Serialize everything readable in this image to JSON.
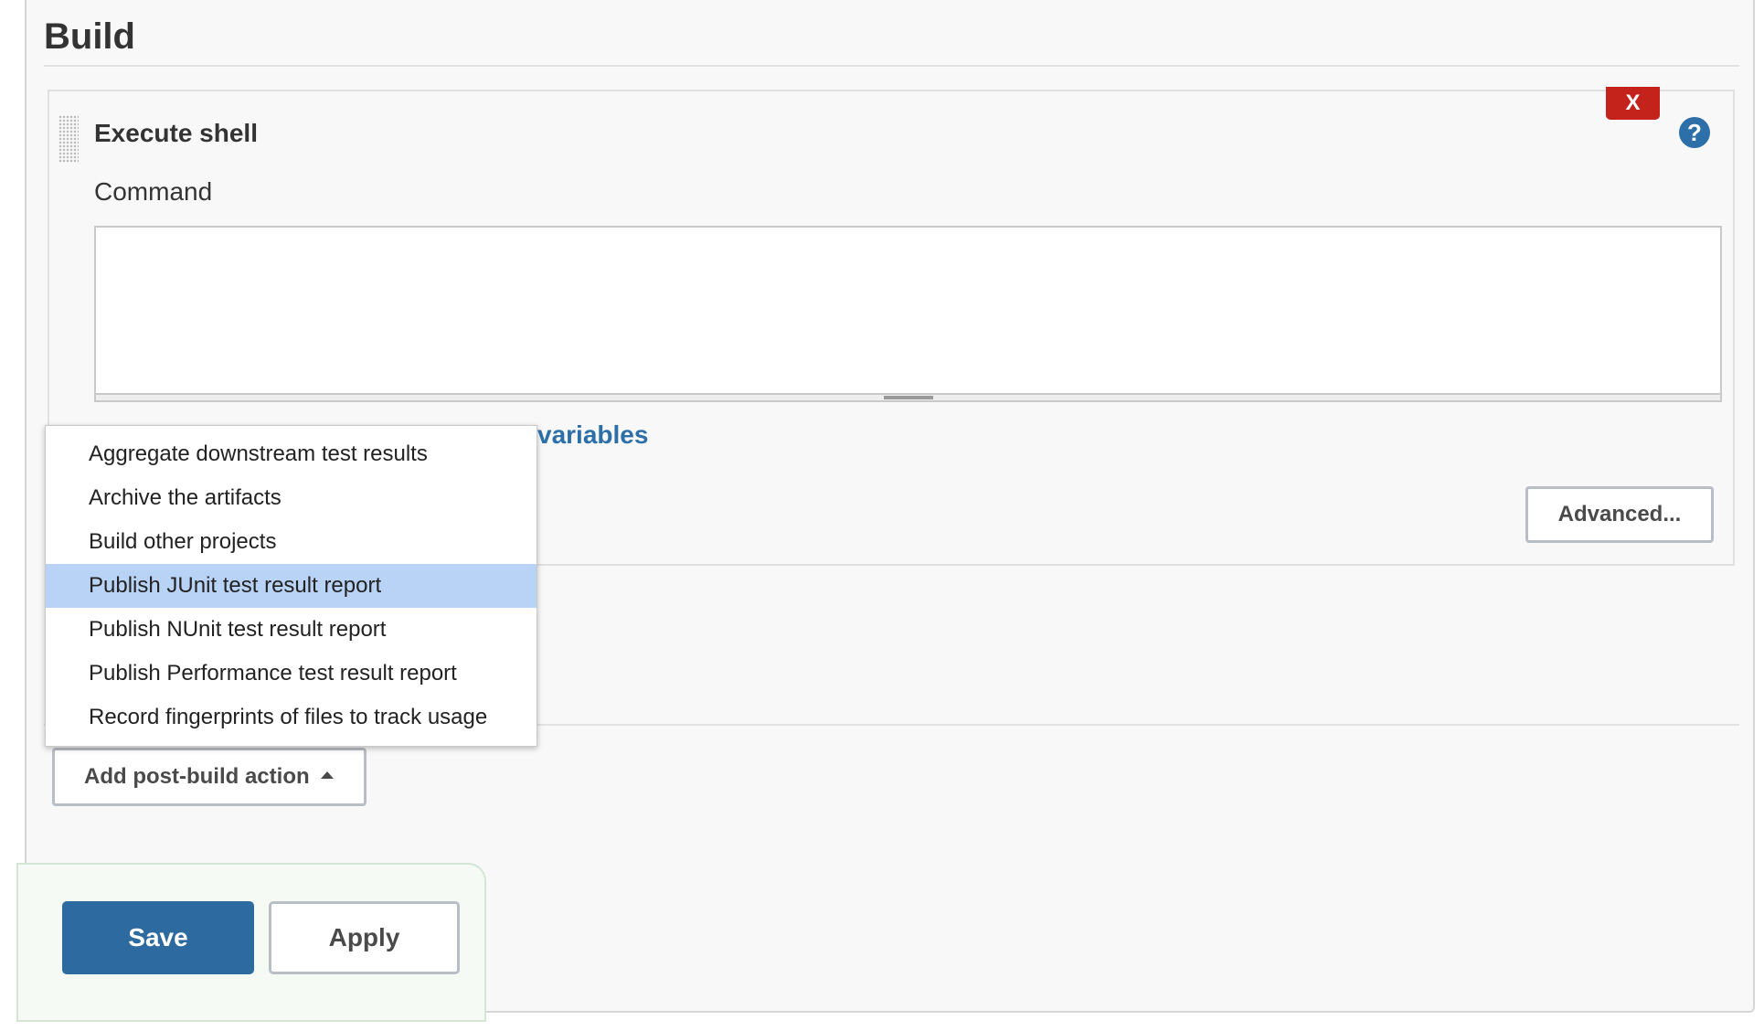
{
  "section": {
    "title": "Build"
  },
  "build_step": {
    "title": "Execute shell",
    "delete_label": "X",
    "help_label": "?",
    "field_label": "Command",
    "command_value": "",
    "env_vars_link_visible_text": "variables",
    "advanced_label": "Advanced..."
  },
  "post_build_menu": {
    "items": [
      {
        "label": "Aggregate downstream test results",
        "highlighted": false
      },
      {
        "label": "Archive the artifacts",
        "highlighted": false
      },
      {
        "label": "Build other projects",
        "highlighted": false
      },
      {
        "label": "Publish JUnit test result report",
        "highlighted": true
      },
      {
        "label": "Publish NUnit test result report",
        "highlighted": false
      },
      {
        "label": "Publish Performance test result report",
        "highlighted": false
      },
      {
        "label": "Record fingerprints of files to track usage",
        "highlighted": false
      }
    ]
  },
  "post_build": {
    "add_label": "Add post-build action",
    "caret_icon": "caret-up-icon"
  },
  "actions": {
    "save_label": "Save",
    "apply_label": "Apply"
  },
  "colors": {
    "save_button": "#2d6aa0",
    "delete_button": "#c4231c",
    "help_icon": "#2d6fa8",
    "link": "#2d6fa8",
    "menu_highlight": "#b8d3f5",
    "action_bar_bg": "#f6faf5"
  }
}
